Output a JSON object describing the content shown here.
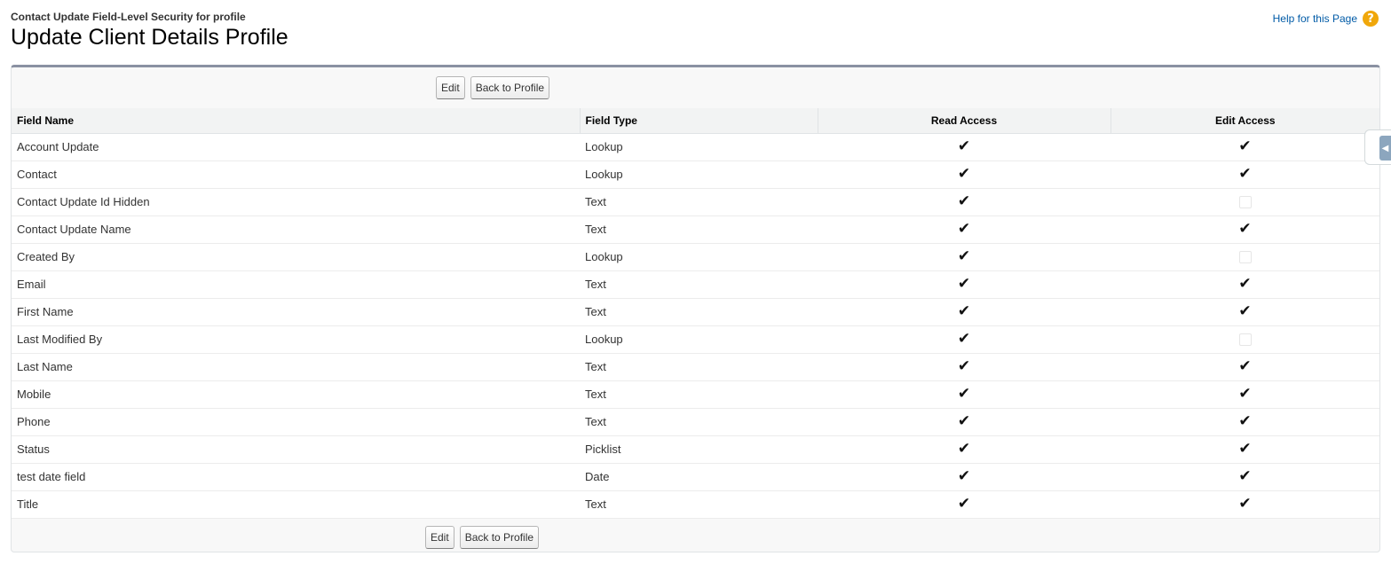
{
  "header": {
    "subtitle": "Contact Update Field-Level Security for profile",
    "title": "Update Client Details Profile",
    "help_link": "Help for this Page",
    "help_icon": "?"
  },
  "buttons": {
    "edit": "Edit",
    "back": "Back to Profile"
  },
  "table": {
    "columns": [
      "Field Name",
      "Field Type",
      "Read Access",
      "Edit Access"
    ],
    "rows": [
      {
        "name": "Account Update",
        "type": "Lookup",
        "read": true,
        "edit": true
      },
      {
        "name": "Contact",
        "type": "Lookup",
        "read": true,
        "edit": true
      },
      {
        "name": "Contact Update Id Hidden",
        "type": "Text",
        "read": true,
        "edit": false
      },
      {
        "name": "Contact Update Name",
        "type": "Text",
        "read": true,
        "edit": true
      },
      {
        "name": "Created By",
        "type": "Lookup",
        "read": true,
        "edit": false
      },
      {
        "name": "Email",
        "type": "Text",
        "read": true,
        "edit": true
      },
      {
        "name": "First Name",
        "type": "Text",
        "read": true,
        "edit": true
      },
      {
        "name": "Last Modified By",
        "type": "Lookup",
        "read": true,
        "edit": false
      },
      {
        "name": "Last Name",
        "type": "Text",
        "read": true,
        "edit": true
      },
      {
        "name": "Mobile",
        "type": "Text",
        "read": true,
        "edit": true
      },
      {
        "name": "Phone",
        "type": "Text",
        "read": true,
        "edit": true
      },
      {
        "name": "Status",
        "type": "Picklist",
        "read": true,
        "edit": true
      },
      {
        "name": "test date field",
        "type": "Date",
        "read": true,
        "edit": true
      },
      {
        "name": "Title",
        "type": "Text",
        "read": true,
        "edit": true
      }
    ]
  },
  "colors": {
    "link": "#015ba7",
    "help_icon": "#f0a70a",
    "block_top_border": "#8a91a2"
  }
}
